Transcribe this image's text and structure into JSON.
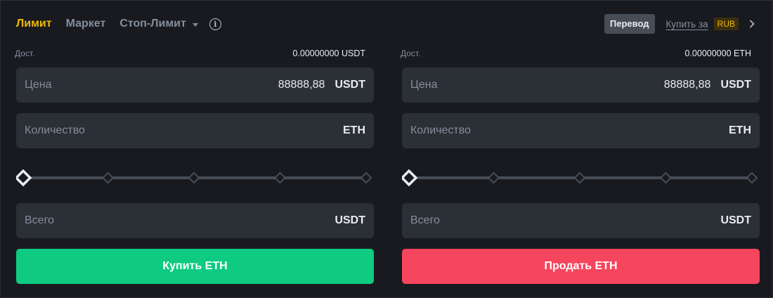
{
  "header": {
    "tabs": [
      {
        "label": "Лимит",
        "active": true
      },
      {
        "label": "Маркет",
        "active": false
      },
      {
        "label": "Стоп-Лимит",
        "active": false,
        "has_dropdown": true
      }
    ],
    "info_icon": "info-icon",
    "transfer_label": "Перевод",
    "buy_for_label": "Купить за",
    "currency": "RUB",
    "chevron_icon": "chevron-right-icon"
  },
  "buy": {
    "avail_label": "Дост.",
    "avail_value": "0.00000000 USDT",
    "price": {
      "label": "Цена",
      "value": "88888,88",
      "unit": "USDT"
    },
    "amount": {
      "label": "Количество",
      "value": "",
      "unit": "ETH"
    },
    "slider_value": 0,
    "slider_stops": [
      0,
      25,
      50,
      75,
      100
    ],
    "total": {
      "label": "Всего",
      "unit": "USDT"
    },
    "action_label": "Купить ETH"
  },
  "sell": {
    "avail_label": "Дост.",
    "avail_value": "0.00000000 ETH",
    "price": {
      "label": "Цена",
      "value": "88888,88",
      "unit": "USDT"
    },
    "amount": {
      "label": "Количество",
      "value": "",
      "unit": "ETH"
    },
    "slider_value": 0,
    "slider_stops": [
      0,
      25,
      50,
      75,
      100
    ],
    "total": {
      "label": "Всего",
      "unit": "USDT"
    },
    "action_label": "Продать ETH"
  },
  "colors": {
    "accent": "#f0b90b",
    "buy": "#0ecb81",
    "sell": "#f6465d",
    "background": "#181a20",
    "field": "#2b2f36"
  }
}
